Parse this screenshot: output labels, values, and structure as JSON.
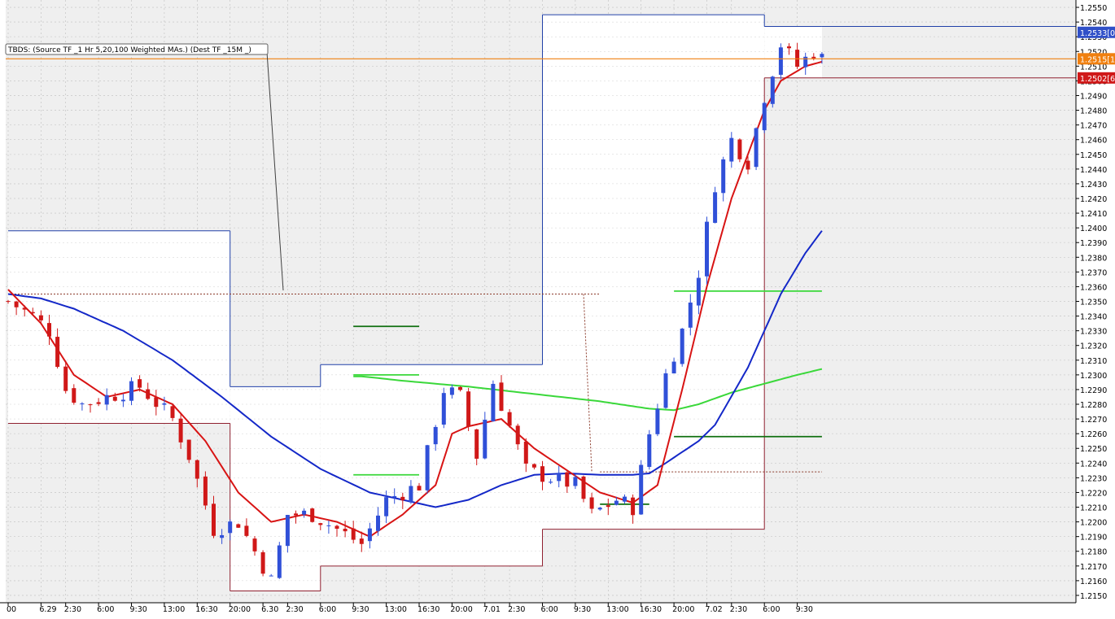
{
  "indicator_label": "TBDS: (Source TF _1 Hr 5,20,100 Weighted MAs.) (Dest TF _15M _)",
  "colors": {
    "bull_candle": "#3050d8",
    "bear_candle": "#d01818",
    "fast_ma": "#d81414",
    "mid_ma": "#1428c8",
    "slow_ma": "#3ad83a",
    "zone_high": "#2040a8",
    "zone_low": "#902030",
    "price_line": "#f08010",
    "dark_green": "#107010"
  },
  "price_tags": [
    {
      "text": "1.2533[0",
      "price": 1.2533,
      "color": "#3050c8"
    },
    {
      "text": "1.2515[1",
      "price": 1.2515,
      "color": "#f08010"
    },
    {
      "text": "1.2502[6",
      "price": 1.2502,
      "color": "#d01818"
    }
  ],
  "chart_data": {
    "type": "candlestick",
    "instrument_timeframe": "15M",
    "ylim": [
      1.2145,
      1.2555
    ],
    "y_ticks": [
      "1.2150",
      "1.2160",
      "1.2170",
      "1.2180",
      "1.2190",
      "1.2200",
      "1.2210",
      "1.2220",
      "1.2230",
      "1.2240",
      "1.2250",
      "1.2260",
      "1.2270",
      "1.2280",
      "1.2290",
      "1.2300",
      "1.2310",
      "1.2320",
      "1.2330",
      "1.2340",
      "1.2350",
      "1.2360",
      "1.2370",
      "1.2380",
      "1.2390",
      "1.2400",
      "1.2410",
      "1.2420",
      "1.2430",
      "1.2440",
      "1.2450",
      "1.2460",
      "1.2470",
      "1.2480",
      "1.2490",
      "1.2500",
      "1.2510",
      "1.2520",
      "1.2530",
      "1.2540",
      "1.2550"
    ],
    "x_ticks": [
      "00",
      "6.29",
      "2:30",
      "6:00",
      "9:30",
      "13:00",
      "16:30",
      "20:00",
      "6.30",
      "2:30",
      "6:00",
      "9:30",
      "13:00",
      "16:30",
      "20:00",
      "7.01",
      "2:30",
      "6:00",
      "9:30",
      "13:00",
      "16:30",
      "20:00",
      "7.02",
      "2:30",
      "6:00",
      "9:30"
    ],
    "x_tick_index": [
      0,
      4,
      7,
      11,
      15,
      19,
      23,
      27,
      31,
      34,
      38,
      42,
      46,
      50,
      54,
      58,
      61,
      65,
      69,
      73,
      77,
      81,
      85,
      88,
      92,
      96
    ],
    "n_bars": 100,
    "anchors": [
      [
        0,
        1.235
      ],
      [
        3,
        1.234
      ],
      [
        5,
        1.233
      ],
      [
        7,
        1.229
      ],
      [
        9,
        1.228
      ],
      [
        12,
        1.2285
      ],
      [
        16,
        1.2292
      ],
      [
        20,
        1.227
      ],
      [
        22,
        1.2245
      ],
      [
        25,
        1.2195
      ],
      [
        28,
        1.22
      ],
      [
        30,
        1.218
      ],
      [
        32,
        1.216
      ],
      [
        34,
        1.2205
      ],
      [
        37,
        1.2205
      ],
      [
        40,
        1.2195
      ],
      [
        43,
        1.2185
      ],
      [
        46,
        1.2215
      ],
      [
        50,
        1.2225
      ],
      [
        53,
        1.229
      ],
      [
        55,
        1.2285
      ],
      [
        57,
        1.2245
      ],
      [
        59,
        1.2295
      ],
      [
        61,
        1.2265
      ],
      [
        63,
        1.2235
      ],
      [
        66,
        1.223
      ],
      [
        69,
        1.2225
      ],
      [
        71,
        1.2205
      ],
      [
        74,
        1.2215
      ],
      [
        76,
        1.221
      ],
      [
        78,
        1.226
      ],
      [
        80,
        1.23
      ],
      [
        82,
        1.233
      ],
      [
        84,
        1.237
      ],
      [
        86,
        1.243
      ],
      [
        88,
        1.246
      ],
      [
        90,
        1.2445
      ],
      [
        92,
        1.249
      ],
      [
        94,
        1.2525
      ],
      [
        96,
        1.251
      ],
      [
        98,
        1.252
      ],
      [
        99,
        1.2515
      ]
    ],
    "fast_ma_anchors": [
      [
        0,
        1.2358
      ],
      [
        4,
        1.2335
      ],
      [
        8,
        1.23
      ],
      [
        12,
        1.2285
      ],
      [
        16,
        1.229
      ],
      [
        20,
        1.228
      ],
      [
        24,
        1.2255
      ],
      [
        28,
        1.222
      ],
      [
        32,
        1.22
      ],
      [
        36,
        1.2205
      ],
      [
        40,
        1.22
      ],
      [
        44,
        1.219
      ],
      [
        48,
        1.2205
      ],
      [
        52,
        1.2225
      ],
      [
        54,
        1.226
      ],
      [
        56,
        1.2265
      ],
      [
        60,
        1.227
      ],
      [
        64,
        1.225
      ],
      [
        68,
        1.2235
      ],
      [
        72,
        1.222
      ],
      [
        76,
        1.2213
      ],
      [
        79,
        1.2225
      ],
      [
        82,
        1.229
      ],
      [
        85,
        1.236
      ],
      [
        88,
        1.242
      ],
      [
        92,
        1.248
      ],
      [
        94,
        1.25
      ],
      [
        97,
        1.251
      ],
      [
        99,
        1.2513
      ]
    ],
    "mid_ma_anchors": [
      [
        0,
        1.2355
      ],
      [
        4,
        1.2352
      ],
      [
        8,
        1.2345
      ],
      [
        14,
        1.233
      ],
      [
        20,
        1.231
      ],
      [
        26,
        1.2285
      ],
      [
        32,
        1.2258
      ],
      [
        38,
        1.2236
      ],
      [
        44,
        1.222
      ],
      [
        48,
        1.2215
      ],
      [
        52,
        1.221
      ],
      [
        56,
        1.2215
      ],
      [
        60,
        1.2225
      ],
      [
        64,
        1.2232
      ],
      [
        68,
        1.2233
      ],
      [
        72,
        1.2232
      ],
      [
        76,
        1.2232
      ],
      [
        78,
        1.2233
      ],
      [
        80,
        1.224
      ],
      [
        84,
        1.2255
      ],
      [
        86,
        1.2266
      ],
      [
        90,
        1.2305
      ],
      [
        94,
        1.2355
      ],
      [
        97,
        1.2383
      ],
      [
        99,
        1.2398
      ]
    ],
    "slow_ma_anchors": [
      [
        43,
        1.2299
      ],
      [
        48,
        1.2296
      ],
      [
        56,
        1.2292
      ],
      [
        64,
        1.2287
      ],
      [
        72,
        1.2282
      ],
      [
        78,
        1.2277
      ],
      [
        81,
        1.2276
      ],
      [
        84,
        1.228
      ],
      [
        88,
        1.2288
      ],
      [
        92,
        1.2294
      ],
      [
        96,
        1.23
      ],
      [
        99,
        1.2304
      ]
    ],
    "zones": [
      {
        "x0": 0,
        "x1": 27,
        "hi": 1.2398,
        "lo": 1.2267
      },
      {
        "x0": 27,
        "x1": 38,
        "hi": 1.2292,
        "lo": 1.2153
      },
      {
        "x0": 38,
        "x1": 65,
        "hi": 1.2307,
        "lo": 1.217
      },
      {
        "x0": 65,
        "x1": 92,
        "hi": 1.2545,
        "lo": 1.2195
      },
      {
        "x0": 92,
        "x1": 99,
        "hi": 1.2537,
        "lo": 1.2502
      }
    ],
    "levels": [
      {
        "x0": 42,
        "x1": 50,
        "price": 1.2333,
        "color": "#107010"
      },
      {
        "x0": 42,
        "x1": 50,
        "price": 1.23,
        "color": "#3ad83a"
      },
      {
        "x0": 42,
        "x1": 50,
        "price": 1.2232,
        "color": "#3ad83a"
      },
      {
        "x0": 81,
        "x1": 99,
        "price": 1.2357,
        "color": "#3ad83a"
      },
      {
        "x0": 81,
        "x1": 99,
        "price": 1.2258,
        "color": "#107010"
      },
      {
        "x0": 72,
        "x1": 78,
        "price": 1.2212,
        "color": "#107010"
      }
    ],
    "dotted_levels": [
      {
        "x0": 0,
        "x1": 72,
        "price": 1.2355
      },
      {
        "x0": 72,
        "x1": 99,
        "price": 1.2234
      }
    ],
    "current_price": 1.2515
  }
}
